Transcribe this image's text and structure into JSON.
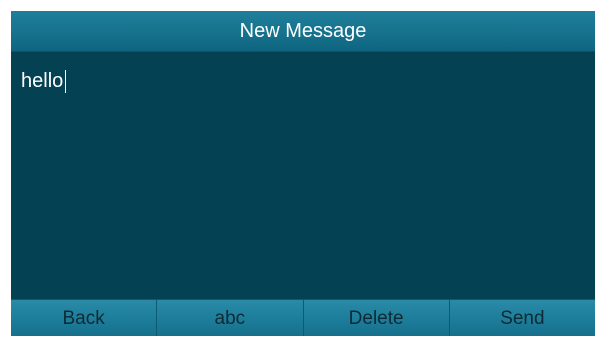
{
  "header": {
    "title": "New Message"
  },
  "message": {
    "text": "hello"
  },
  "softkeys": [
    {
      "label": "Back"
    },
    {
      "label": "abc"
    },
    {
      "label": "Delete"
    },
    {
      "label": "Send"
    }
  ],
  "colors": {
    "screen_background": "#034153",
    "title_bar": "#16728d",
    "softkey_bar": "#1d7e9b",
    "title_text": "#ffffff",
    "softkey_text": "#0e2a35"
  }
}
